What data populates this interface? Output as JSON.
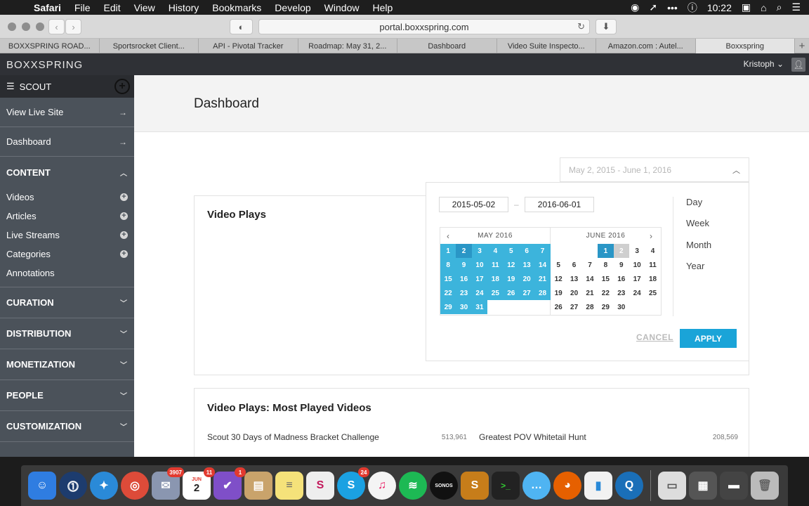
{
  "menubar": {
    "app": "Safari",
    "items": [
      "File",
      "Edit",
      "View",
      "History",
      "Bookmarks",
      "Develop",
      "Window",
      "Help"
    ],
    "time": "10:22"
  },
  "browser": {
    "url": "portal.boxxspring.com",
    "tabs": [
      "BOXXSPRING ROAD...",
      "Sportsrocket Client...",
      "API - Pivotal Tracker",
      "Roadmap: May 31, 2...",
      "Dashboard",
      "Video Suite Inspecto...",
      "Amazon.com : Autel...",
      "Boxxspring"
    ],
    "active_tab_index": 7
  },
  "app": {
    "logo": "BOXXSPRING",
    "user": "Kristoph"
  },
  "sidebar": {
    "scout": "SCOUT",
    "links": [
      "View Live Site",
      "Dashboard"
    ],
    "content_label": "CONTENT",
    "content_items": [
      {
        "label": "Videos",
        "has_add": true
      },
      {
        "label": "Articles",
        "has_add": true
      },
      {
        "label": "Live Streams",
        "has_add": true
      },
      {
        "label": "Categories",
        "has_add": true
      },
      {
        "label": "Annotations",
        "has_add": false
      }
    ],
    "sections": [
      "CURATION",
      "DISTRIBUTION",
      "MONETIZATION",
      "PEOPLE",
      "CUSTOMIZATION"
    ]
  },
  "main": {
    "title": "Dashboard",
    "date_range": "May 2, 2015 - June 1, 2016",
    "video_plays_title": "Video Plays",
    "most_played_title": "Video Plays: Most Played Videos",
    "most_played": [
      {
        "title": "Scout 30 Days of Madness Bracket Challenge",
        "value": "513,961"
      },
      {
        "title": "Greatest POV Whitetail Hunt",
        "value": "208,569"
      }
    ]
  },
  "picker": {
    "start": "2015-05-02",
    "end": "2016-06-01",
    "month1": "MAY 2016",
    "month2": "JUNE 2016",
    "granularity": [
      "Day",
      "Week",
      "Month",
      "Year"
    ],
    "cancel": "CANCEL",
    "apply": "APPLY"
  },
  "dock": {
    "badges": {
      "mail": "3907",
      "calendar_month": "JUN",
      "calendar_day": "11",
      "calendar_date": "2",
      "omnifocus": "1",
      "skype": "24"
    }
  }
}
